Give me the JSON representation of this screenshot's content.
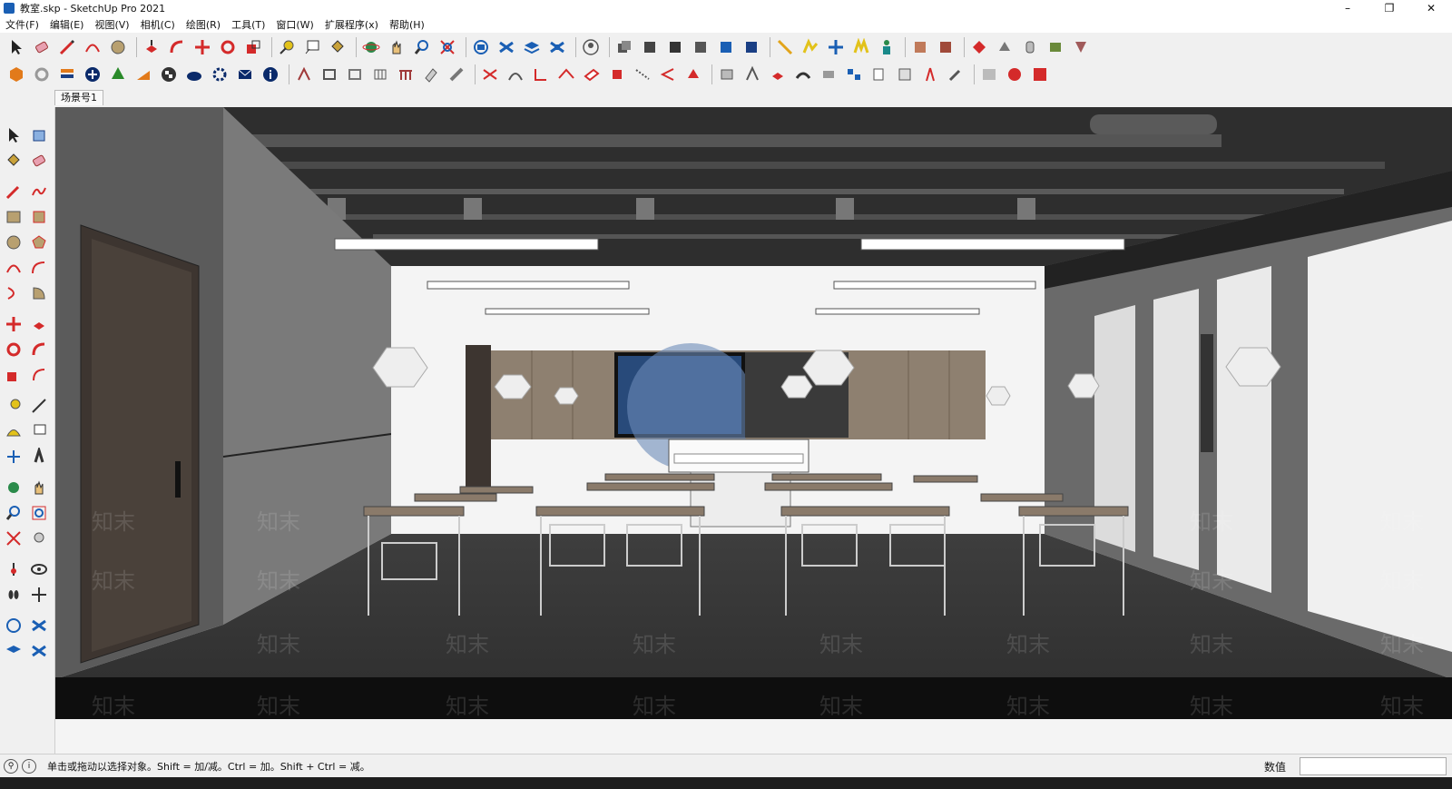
{
  "window": {
    "title": "教室.skp - SketchUp Pro 2021",
    "minimize": "–",
    "maximize": "❐",
    "close": "✕"
  },
  "menus": [
    "文件(F)",
    "编辑(E)",
    "视图(V)",
    "相机(C)",
    "绘图(R)",
    "工具(T)",
    "窗口(W)",
    "扩展程序(x)",
    "帮助(H)"
  ],
  "scene_tabs": [
    "场景号1"
  ],
  "statusbar": {
    "hint": "单击或拖动以选择对象。Shift = 加/减。Ctrl = 加。Shift + Ctrl = 减。",
    "measurements_label": "数值",
    "measurements_value": ""
  },
  "viewport": {
    "watermark": "知末"
  },
  "colors": {
    "toolbar_bg": "#f0f0f0",
    "accent_red": "#d42a2a",
    "accent_blue": "#1a5fb4"
  }
}
